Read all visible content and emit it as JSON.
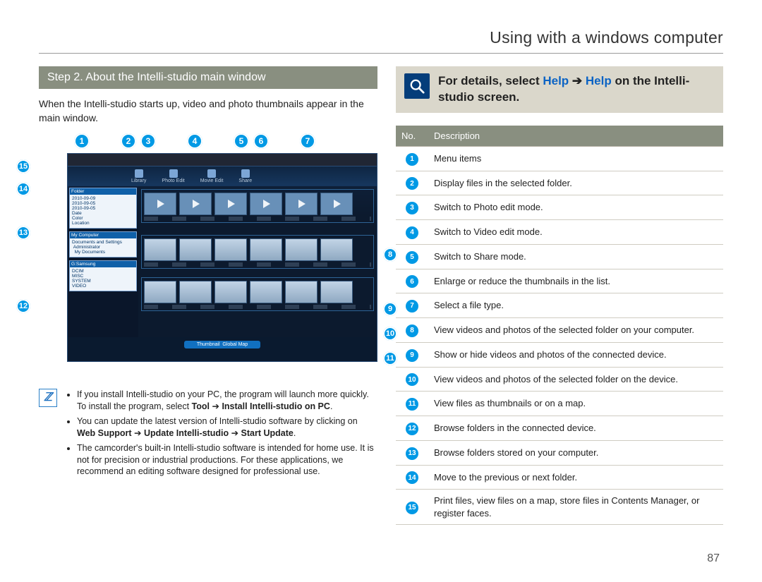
{
  "title": "Using with a windows computer",
  "page_number": "87",
  "step_header": "Step 2. About the Intelli-studio main window",
  "intro_text": "When the Intelli-studio starts up, video and photo thumbnails appear in the main window.",
  "help_box": {
    "prefix": "For details, select ",
    "help1": "Help",
    "arrow": " ➔ ",
    "help2": "Help",
    "suffix": " on the Intelli-studio screen."
  },
  "table": {
    "col1": "No.",
    "col2": "Description",
    "rows": [
      {
        "n": "1",
        "d": "Menu items"
      },
      {
        "n": "2",
        "d": "Display files in the selected folder."
      },
      {
        "n": "3",
        "d": "Switch to Photo edit mode."
      },
      {
        "n": "4",
        "d": "Switch to Video edit mode."
      },
      {
        "n": "5",
        "d": "Switch to Share mode."
      },
      {
        "n": "6",
        "d": "Enlarge or reduce the thumbnails in the list."
      },
      {
        "n": "7",
        "d": "Select a file type."
      },
      {
        "n": "8",
        "d": "View videos and photos of the selected folder on your computer."
      },
      {
        "n": "9",
        "d": "Show or hide videos and photos of the connected device."
      },
      {
        "n": "10",
        "d": "View videos and photos of the selected folder on the device."
      },
      {
        "n": "11",
        "d": "View files as thumbnails or on a map."
      },
      {
        "n": "12",
        "d": "Browse folders in the connected device."
      },
      {
        "n": "13",
        "d": "Browse folders stored on your computer."
      },
      {
        "n": "14",
        "d": "Move to the previous or next folder."
      },
      {
        "n": "15",
        "d": "Print files, view files on a map, store files in Contents Manager, or register faces."
      }
    ]
  },
  "notes": {
    "n1_a": "If you install Intelli-studio on your PC, the program will launch more quickly. To install the program, select ",
    "n1_b": "Tool",
    "n1_c": " ➔ ",
    "n1_d": "Install Intelli-studio on PC",
    "n1_e": ".",
    "n2_a": "You can update the latest version of Intelli-studio software by clicking on ",
    "n2_b": "Web Support",
    "n2_c": "  ➔ ",
    "n2_d": "Update Intelli-studio",
    "n2_e": " ➔ ",
    "n2_f": "Start Update",
    "n2_g": ".",
    "n3": "The camcorder's built-in Intelli-studio software is intended for home use. It is not for precision or industrial productions. For these applications, we recommend an editing software designed for professional use."
  },
  "callouts": {
    "top": [
      "1",
      "2",
      "3",
      "4",
      "5",
      "6",
      "7"
    ],
    "right": [
      "8",
      "9",
      "10",
      "11"
    ],
    "left": [
      "15",
      "14",
      "13",
      "12"
    ]
  }
}
